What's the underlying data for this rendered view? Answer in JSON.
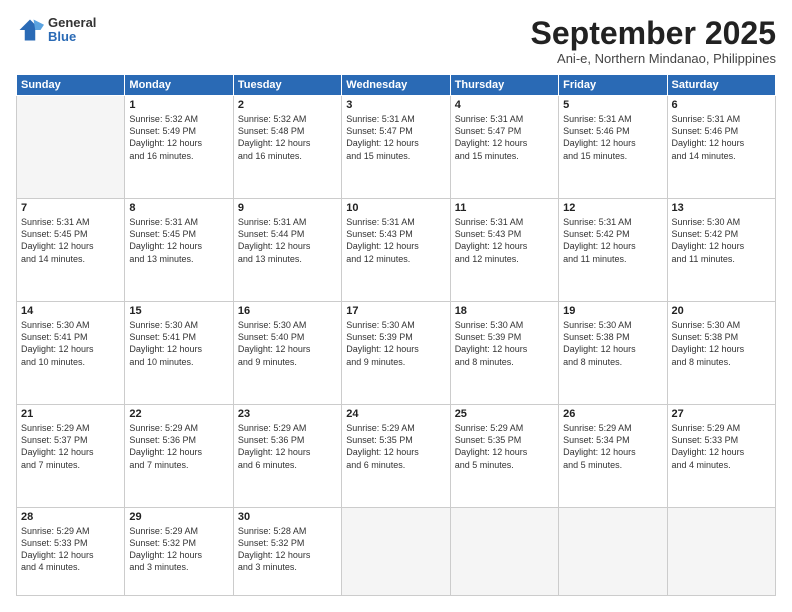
{
  "logo": {
    "general": "General",
    "blue": "Blue"
  },
  "header": {
    "month": "September 2025",
    "location": "Ani-e, Northern Mindanao, Philippines"
  },
  "weekdays": [
    "Sunday",
    "Monday",
    "Tuesday",
    "Wednesday",
    "Thursday",
    "Friday",
    "Saturday"
  ],
  "weeks": [
    [
      {
        "day": "",
        "info": ""
      },
      {
        "day": "1",
        "info": "Sunrise: 5:32 AM\nSunset: 5:49 PM\nDaylight: 12 hours\nand 16 minutes."
      },
      {
        "day": "2",
        "info": "Sunrise: 5:32 AM\nSunset: 5:48 PM\nDaylight: 12 hours\nand 16 minutes."
      },
      {
        "day": "3",
        "info": "Sunrise: 5:31 AM\nSunset: 5:47 PM\nDaylight: 12 hours\nand 15 minutes."
      },
      {
        "day": "4",
        "info": "Sunrise: 5:31 AM\nSunset: 5:47 PM\nDaylight: 12 hours\nand 15 minutes."
      },
      {
        "day": "5",
        "info": "Sunrise: 5:31 AM\nSunset: 5:46 PM\nDaylight: 12 hours\nand 15 minutes."
      },
      {
        "day": "6",
        "info": "Sunrise: 5:31 AM\nSunset: 5:46 PM\nDaylight: 12 hours\nand 14 minutes."
      }
    ],
    [
      {
        "day": "7",
        "info": "Sunrise: 5:31 AM\nSunset: 5:45 PM\nDaylight: 12 hours\nand 14 minutes."
      },
      {
        "day": "8",
        "info": "Sunrise: 5:31 AM\nSunset: 5:45 PM\nDaylight: 12 hours\nand 13 minutes."
      },
      {
        "day": "9",
        "info": "Sunrise: 5:31 AM\nSunset: 5:44 PM\nDaylight: 12 hours\nand 13 minutes."
      },
      {
        "day": "10",
        "info": "Sunrise: 5:31 AM\nSunset: 5:43 PM\nDaylight: 12 hours\nand 12 minutes."
      },
      {
        "day": "11",
        "info": "Sunrise: 5:31 AM\nSunset: 5:43 PM\nDaylight: 12 hours\nand 12 minutes."
      },
      {
        "day": "12",
        "info": "Sunrise: 5:31 AM\nSunset: 5:42 PM\nDaylight: 12 hours\nand 11 minutes."
      },
      {
        "day": "13",
        "info": "Sunrise: 5:30 AM\nSunset: 5:42 PM\nDaylight: 12 hours\nand 11 minutes."
      }
    ],
    [
      {
        "day": "14",
        "info": "Sunrise: 5:30 AM\nSunset: 5:41 PM\nDaylight: 12 hours\nand 10 minutes."
      },
      {
        "day": "15",
        "info": "Sunrise: 5:30 AM\nSunset: 5:41 PM\nDaylight: 12 hours\nand 10 minutes."
      },
      {
        "day": "16",
        "info": "Sunrise: 5:30 AM\nSunset: 5:40 PM\nDaylight: 12 hours\nand 9 minutes."
      },
      {
        "day": "17",
        "info": "Sunrise: 5:30 AM\nSunset: 5:39 PM\nDaylight: 12 hours\nand 9 minutes."
      },
      {
        "day": "18",
        "info": "Sunrise: 5:30 AM\nSunset: 5:39 PM\nDaylight: 12 hours\nand 8 minutes."
      },
      {
        "day": "19",
        "info": "Sunrise: 5:30 AM\nSunset: 5:38 PM\nDaylight: 12 hours\nand 8 minutes."
      },
      {
        "day": "20",
        "info": "Sunrise: 5:30 AM\nSunset: 5:38 PM\nDaylight: 12 hours\nand 8 minutes."
      }
    ],
    [
      {
        "day": "21",
        "info": "Sunrise: 5:29 AM\nSunset: 5:37 PM\nDaylight: 12 hours\nand 7 minutes."
      },
      {
        "day": "22",
        "info": "Sunrise: 5:29 AM\nSunset: 5:36 PM\nDaylight: 12 hours\nand 7 minutes."
      },
      {
        "day": "23",
        "info": "Sunrise: 5:29 AM\nSunset: 5:36 PM\nDaylight: 12 hours\nand 6 minutes."
      },
      {
        "day": "24",
        "info": "Sunrise: 5:29 AM\nSunset: 5:35 PM\nDaylight: 12 hours\nand 6 minutes."
      },
      {
        "day": "25",
        "info": "Sunrise: 5:29 AM\nSunset: 5:35 PM\nDaylight: 12 hours\nand 5 minutes."
      },
      {
        "day": "26",
        "info": "Sunrise: 5:29 AM\nSunset: 5:34 PM\nDaylight: 12 hours\nand 5 minutes."
      },
      {
        "day": "27",
        "info": "Sunrise: 5:29 AM\nSunset: 5:33 PM\nDaylight: 12 hours\nand 4 minutes."
      }
    ],
    [
      {
        "day": "28",
        "info": "Sunrise: 5:29 AM\nSunset: 5:33 PM\nDaylight: 12 hours\nand 4 minutes."
      },
      {
        "day": "29",
        "info": "Sunrise: 5:29 AM\nSunset: 5:32 PM\nDaylight: 12 hours\nand 3 minutes."
      },
      {
        "day": "30",
        "info": "Sunrise: 5:28 AM\nSunset: 5:32 PM\nDaylight: 12 hours\nand 3 minutes."
      },
      {
        "day": "",
        "info": ""
      },
      {
        "day": "",
        "info": ""
      },
      {
        "day": "",
        "info": ""
      },
      {
        "day": "",
        "info": ""
      }
    ]
  ]
}
